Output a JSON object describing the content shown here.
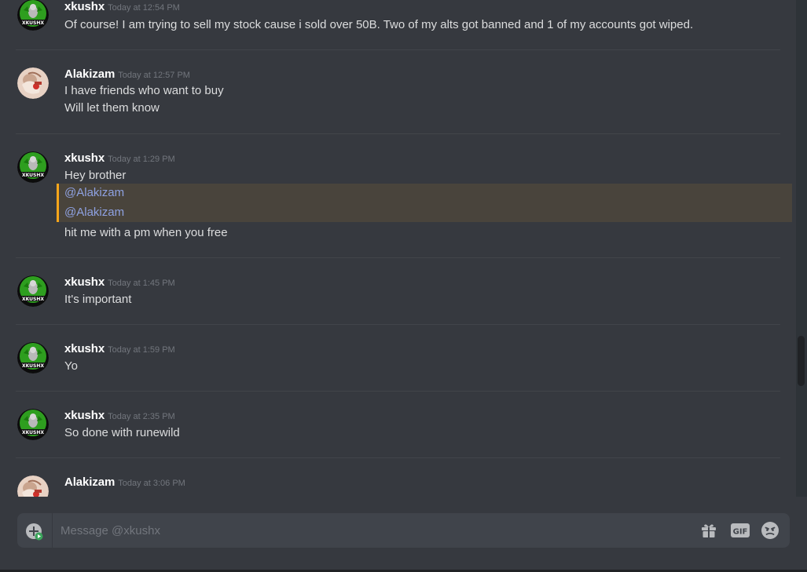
{
  "messages": [
    {
      "author": "xkushx",
      "time": "Today at 12:54 PM",
      "avatar": "xkushx-avatar",
      "lines": [
        "Of course! I am trying to sell my stock cause i sold over 50B. Two of my alts got banned and 1 of my accounts got wiped."
      ]
    },
    {
      "author": "Alakizam",
      "time": "Today at 12:57 PM",
      "avatar": "alakizam-avatar",
      "lines": [
        "I have friends who want to buy",
        "Will let them know"
      ]
    },
    {
      "author": "xkushx",
      "time": "Today at 1:29 PM",
      "avatar": "xkushx-avatar",
      "lines": [
        "Hey brother"
      ],
      "mentions": [
        "@Alakizam",
        "@Alakizam"
      ],
      "after": "hit me with a pm when you free"
    },
    {
      "author": "xkushx",
      "time": "Today at 1:45 PM",
      "avatar": "xkushx-avatar",
      "lines": [
        "It's important"
      ]
    },
    {
      "author": "xkushx",
      "time": "Today at 1:59 PM",
      "avatar": "xkushx-avatar",
      "lines": [
        "Yo"
      ]
    },
    {
      "author": "xkushx",
      "time": "Today at 2:35 PM",
      "avatar": "xkushx-avatar",
      "lines": [
        "So done with runewild"
      ]
    },
    {
      "author": "Alakizam",
      "time": "Today at 3:06 PM",
      "avatar": "alakizam-avatar",
      "lines": []
    }
  ],
  "composer": {
    "placeholder": "Message @xkushx",
    "attach_icon": "plus-circle-icon",
    "gift_icon": "gift-icon",
    "gif_label": "GIF",
    "emoji_icon": "emoji-icon"
  },
  "colors": {
    "background": "#36393f",
    "composer": "#40444b",
    "mention_bar": "#faa61a",
    "mention_bg": "#49443c",
    "mention_text": "#8ea1e1"
  }
}
